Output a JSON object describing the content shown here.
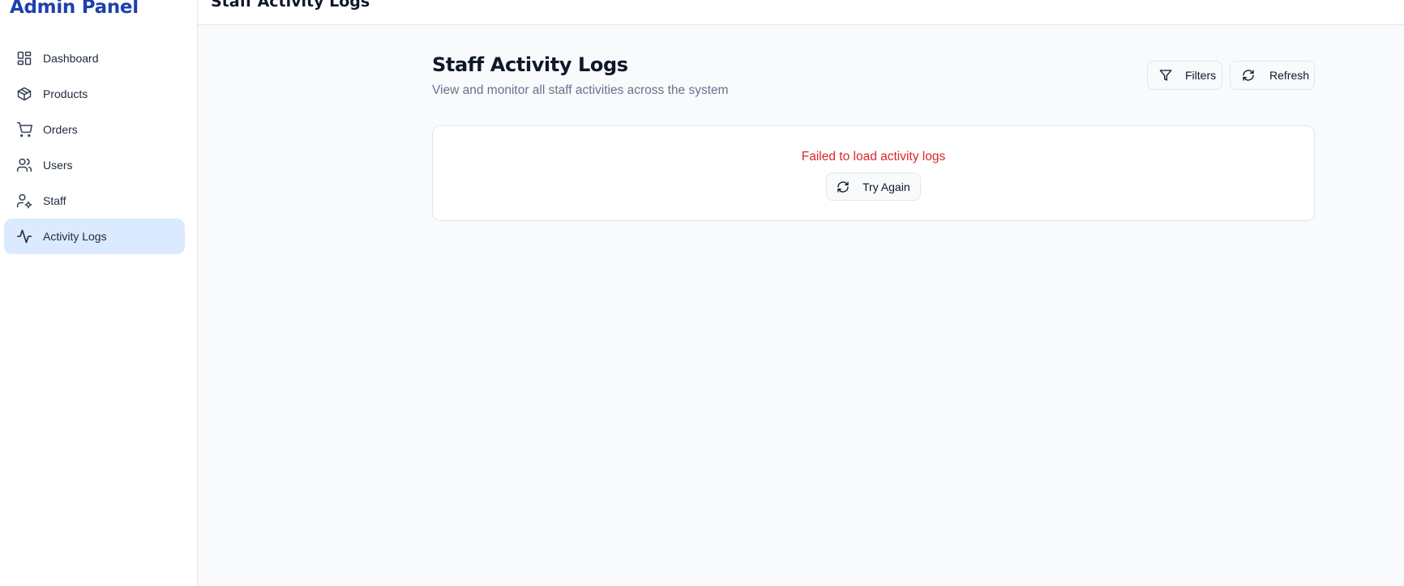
{
  "sidebar": {
    "brand": "Admin Panel",
    "items": [
      {
        "label": "Dashboard",
        "icon": "layout-dashboard-icon"
      },
      {
        "label": "Products",
        "icon": "package-icon"
      },
      {
        "label": "Orders",
        "icon": "shopping-cart-icon"
      },
      {
        "label": "Users",
        "icon": "users-icon"
      },
      {
        "label": "Staff",
        "icon": "user-cog-icon"
      },
      {
        "label": "Activity Logs",
        "icon": "activity-icon",
        "active": true
      }
    ]
  },
  "header": {
    "title": "Staff Activity Logs"
  },
  "main": {
    "title": "Staff Activity Logs",
    "subtitle": "View and monitor all staff activities across the system",
    "filters_label": "Filters",
    "refresh_label": "Refresh",
    "error_message": "Failed to load activity logs",
    "retry_label": "Try Again"
  },
  "colors": {
    "brand": "#1e40af",
    "active_nav_bg": "#dbeafe",
    "error": "#dc2626",
    "page_bg": "#f8fafc",
    "muted_text": "#64748b"
  }
}
